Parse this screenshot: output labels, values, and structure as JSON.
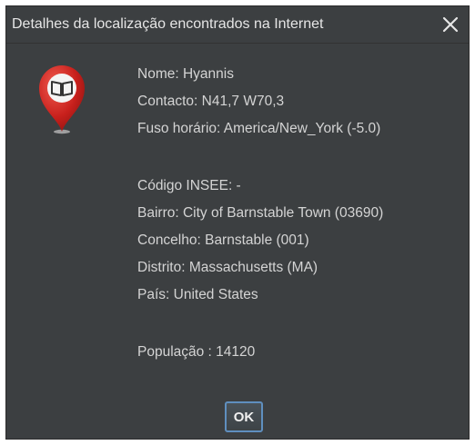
{
  "window": {
    "title": "Detalhes da localização encontrados na Internet"
  },
  "icons": {
    "pin": "map-pin-book-icon",
    "close": "close-icon",
    "pin_color": "#c8201c",
    "book_color": "#333333"
  },
  "details": {
    "nome": "Nome: Hyannis",
    "contacto": "Contacto: N41,7 W70,3",
    "fuso": "Fuso horário: America/New_York (-5.0)",
    "insee": "Código INSEE: -",
    "bairro": "Bairro: City of Barnstable Town (03690)",
    "concelho": "Concelho: Barnstable (001)",
    "distrito": "Distrito: Massachusetts (MA)",
    "pais": "País: United States",
    "populacao": "População : 14120"
  },
  "buttons": {
    "ok": "OK"
  },
  "colors": {
    "dialog_bg": "#3c3f41",
    "text": "#d4d4d4",
    "ok_border": "#5f8fbf"
  }
}
